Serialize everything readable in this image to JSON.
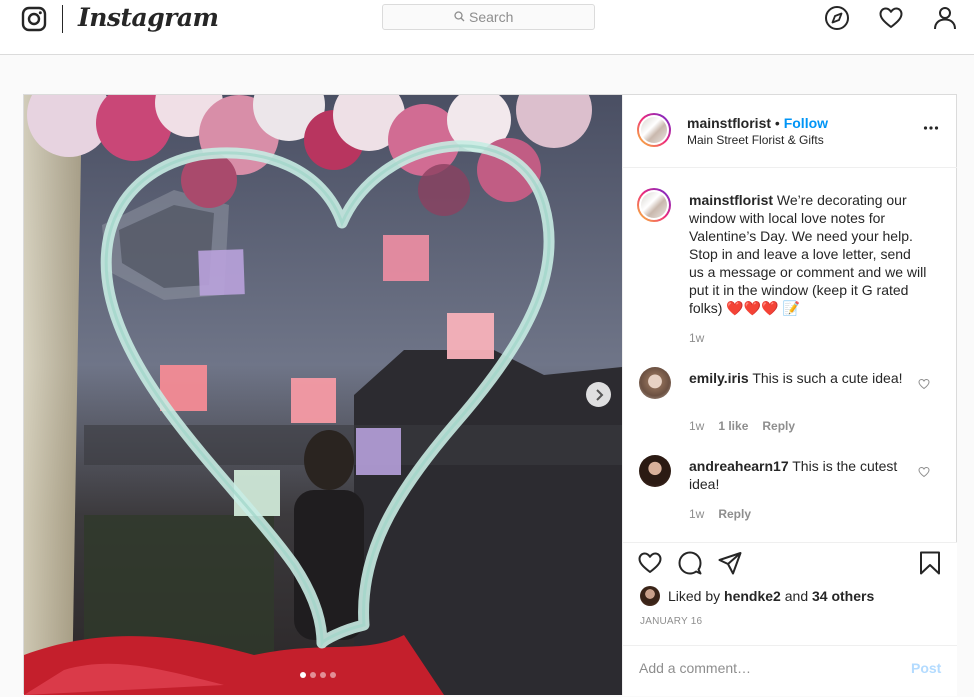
{
  "nav": {
    "brand": "Instagram",
    "search_placeholder": "Search"
  },
  "post": {
    "username": "mainstflorist",
    "separator": "•",
    "follow_label": "Follow",
    "location": "Main Street Florist & Gifts",
    "caption": {
      "username": "mainstflorist",
      "text": "We’re decorating our window with local love notes for Valentine’s Day. We need your help. Stop in and leave a love letter, send us a message or comment and we will put it in the window (keep it G rated folks) ❤️❤️❤️ 📝",
      "time": "1w"
    },
    "comments": [
      {
        "username": "emily.iris",
        "text": "This is such a cute idea!",
        "time": "1w",
        "likes": "1 like",
        "reply": "Reply"
      },
      {
        "username": "andreahearn17",
        "text": "This is the cutest idea!",
        "time": "1w",
        "reply": "Reply"
      }
    ],
    "liked_by": {
      "prefix": "Liked by",
      "user": "hendke2",
      "and": "and",
      "others": "34 others"
    },
    "date": "JANUARY 16",
    "comment_placeholder": "Add a comment…",
    "post_label": "Post",
    "carousel": {
      "count": 4,
      "active": 1
    }
  },
  "colors": {
    "accent": "#0095f6",
    "post_disabled": "#b3dbff",
    "heart_outline": "#bde5dd"
  }
}
